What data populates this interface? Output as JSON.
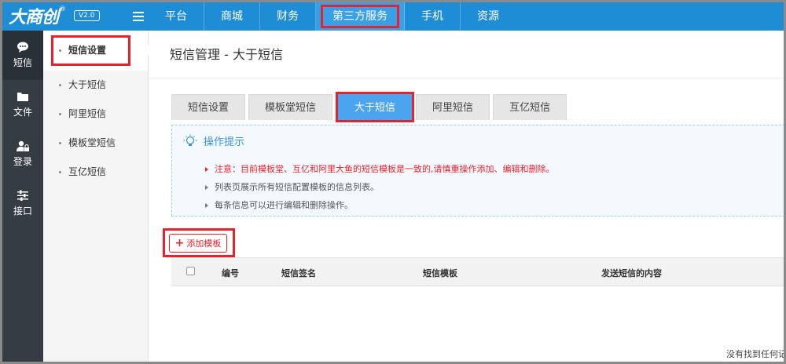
{
  "app": {
    "logo_text": "大商创",
    "logo_reg": "®",
    "version": "V2.0"
  },
  "nav": {
    "items": [
      {
        "label": "平台"
      },
      {
        "label": "商城"
      },
      {
        "label": "财务"
      },
      {
        "label": "第三方服务",
        "active": true
      },
      {
        "label": "手机"
      },
      {
        "label": "资源"
      }
    ]
  },
  "leftbar": {
    "items": [
      {
        "label": "短信",
        "icon": "chat-icon",
        "active": true
      },
      {
        "label": "文件",
        "icon": "folder-icon"
      },
      {
        "label": "登录",
        "icon": "user-lock-icon"
      },
      {
        "label": "接口",
        "icon": "sliders-icon"
      }
    ]
  },
  "subbar": {
    "items": [
      {
        "label": "短信设置",
        "active": true
      },
      {
        "label": "大于短信"
      },
      {
        "label": "阿里短信"
      },
      {
        "label": "模板堂短信"
      },
      {
        "label": "互亿短信"
      }
    ]
  },
  "main": {
    "title": "短信管理 - 大于短信",
    "tabs": [
      {
        "label": "短信设置"
      },
      {
        "label": "模板堂短信"
      },
      {
        "label": "大于短信",
        "active": true
      },
      {
        "label": "阿里短信"
      },
      {
        "label": "互亿短信"
      }
    ],
    "tip": {
      "heading": "操作提示",
      "lines": [
        "注意：目前模板堂、互亿和阿里大鱼的短信模板是一致的,请慎重操作添加、编辑和删除。",
        "列表页展示所有短信配置模板的信息列表。",
        "每条信息可以进行编辑和删除操作。"
      ]
    },
    "add_button": "添加模板",
    "table": {
      "columns": [
        "编号",
        "短信签名",
        "短信模板",
        "发送短信的内容"
      ]
    },
    "empty_text": "没有找到任何记"
  },
  "colors": {
    "topbar": "#1f8dd6",
    "highlight": "#e8222c",
    "active_tab": "#4aa5ee",
    "sidebar_dark": "#353c44"
  }
}
